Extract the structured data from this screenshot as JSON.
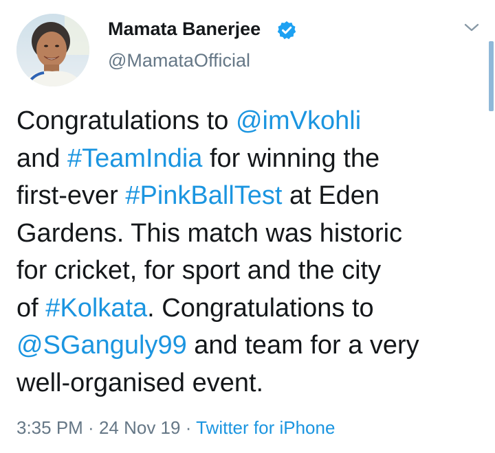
{
  "author": {
    "display_name": "Mamata Banerjee",
    "handle": "@MamataOfficial",
    "verified": true,
    "avatar_icon": "profile-photo"
  },
  "tweet": {
    "lines": [
      [
        {
          "t": "Congratulations to ",
          "link": false
        },
        {
          "t": "@imVkohli",
          "link": true
        }
      ],
      [
        {
          "t": "and ",
          "link": false
        },
        {
          "t": "#TeamIndia",
          "link": true
        },
        {
          "t": " for winning the",
          "link": false
        }
      ],
      [
        {
          "t": "first-ever ",
          "link": false
        },
        {
          "t": "#PinkBallTest",
          "link": true
        },
        {
          "t": " at Eden",
          "link": false
        }
      ],
      [
        {
          "t": "Gardens. This match was historic",
          "link": false
        }
      ],
      [
        {
          "t": "for cricket, for sport and the city",
          "link": false
        }
      ],
      [
        {
          "t": "of ",
          "link": false
        },
        {
          "t": "#Kolkata",
          "link": true
        },
        {
          "t": ". Congratulations to",
          "link": false
        }
      ],
      [
        {
          "t": "@SGanguly99",
          "link": true
        },
        {
          "t": " and team for a very",
          "link": false
        }
      ],
      [
        {
          "t": "well-organised event.",
          "link": false
        }
      ]
    ]
  },
  "meta": {
    "time": "3:35 PM",
    "sep1": " · ",
    "date": "24 Nov 19",
    "sep2": " · ",
    "source": "Twitter for iPhone"
  },
  "colors": {
    "link": "#1b95e0",
    "secondary_text": "#657786",
    "primary_text": "#14171a",
    "verified_badge": "#1da1f2"
  },
  "icons": {
    "verified": "verified-badge-icon",
    "menu": "chevron-down-icon"
  }
}
